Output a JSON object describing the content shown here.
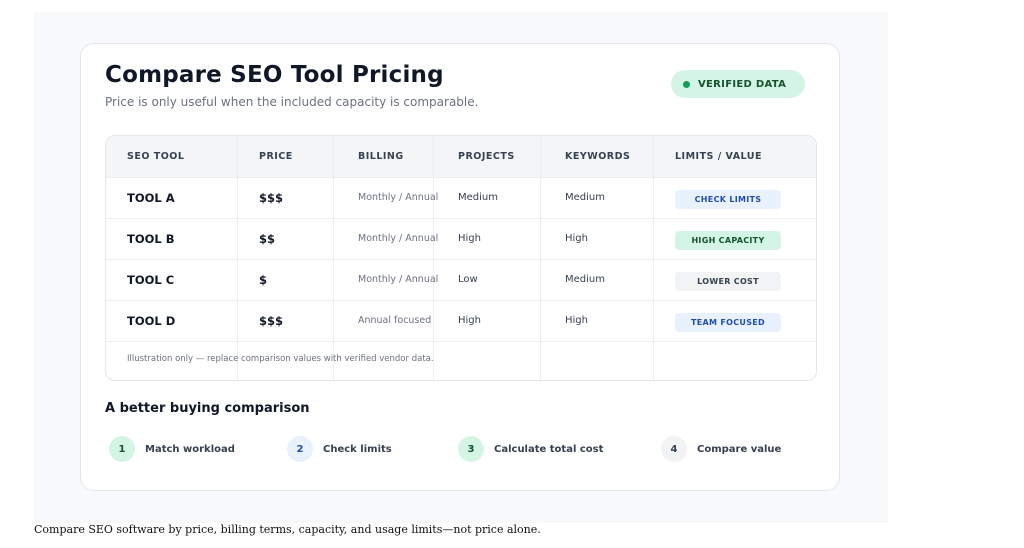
{
  "header": {
    "title": "Compare SEO Tool Pricing",
    "subtitle": "Price is only useful when the included capacity is comparable."
  },
  "badge": {
    "label": "VERIFIED DATA",
    "color": "#0f9d58"
  },
  "table": {
    "columns": [
      "SEO TOOL",
      "PRICE",
      "BILLING",
      "PROJECTS",
      "KEYWORDS",
      "LIMITS / VALUE"
    ],
    "rows": [
      {
        "tool": "TOOL A",
        "price": "$$$",
        "billing": "Monthly / Annual",
        "projects": "Medium",
        "keywords": "Medium",
        "limit": "CHECK LIMITS",
        "limit_bg": "#e8f1fd",
        "limit_fg": "#1e4fa8"
      },
      {
        "tool": "TOOL B",
        "price": "$$",
        "billing": "Monthly / Annual",
        "projects": "High",
        "keywords": "High",
        "limit": "HIGH CAPACITY",
        "limit_bg": "#d4f5e5",
        "limit_fg": "#14532d"
      },
      {
        "tool": "TOOL C",
        "price": "$",
        "billing": "Monthly / Annual",
        "projects": "Low",
        "keywords": "Medium",
        "limit": "LOWER COST",
        "limit_bg": "#f1f3f5",
        "limit_fg": "#374151"
      },
      {
        "tool": "TOOL D",
        "price": "$$$",
        "billing": "Annual focused",
        "projects": "High",
        "keywords": "High",
        "limit": "TEAM FOCUSED",
        "limit_bg": "#e8f1fd",
        "limit_fg": "#1e4fa8"
      }
    ],
    "footnote": "Illustration only — replace comparison values with verified vendor data."
  },
  "buying": {
    "title": "A better buying comparison",
    "steps": [
      {
        "num": "1",
        "label": "Match workload",
        "bg": "#d4f5e5",
        "fg": "#14532d"
      },
      {
        "num": "2",
        "label": "Check limits",
        "bg": "#e8f1fd",
        "fg": "#1e4fa8"
      },
      {
        "num": "3",
        "label": "Calculate total cost",
        "bg": "#d4f5e5",
        "fg": "#14532d"
      },
      {
        "num": "4",
        "label": "Compare value",
        "bg": "#f1f3f5",
        "fg": "#374151"
      }
    ]
  },
  "caption": "Compare SEO software by price, billing terms, capacity, and usage limits—not price alone."
}
